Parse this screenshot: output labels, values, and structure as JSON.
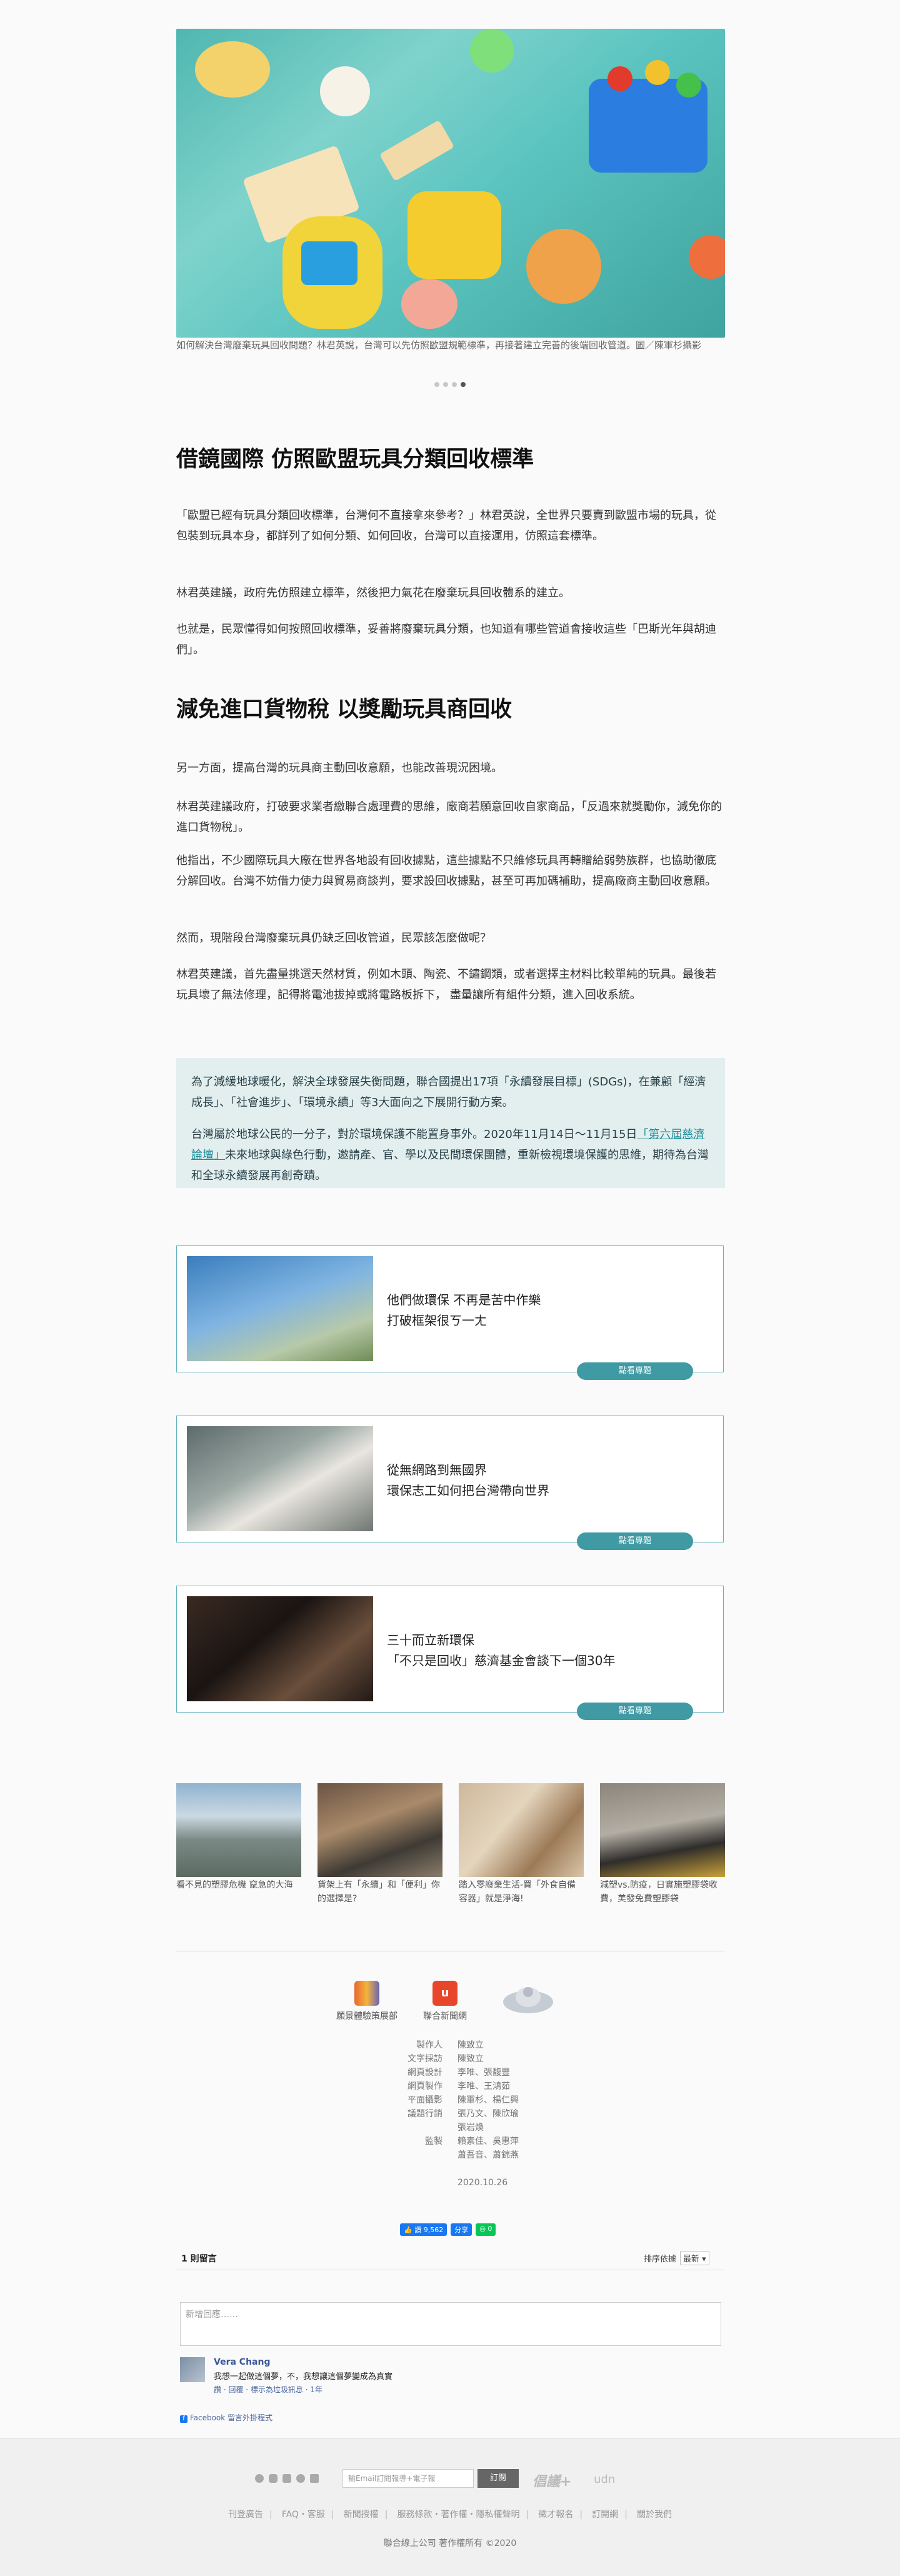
{
  "hero": {
    "caption": "如何解決台灣廢棄玩具回收問題？林君英說，台灣可以先仿照歐盟規範標準，再接著建立完善的後端回收管道。圖／陳軍杉攝影"
  },
  "section1": {
    "heading": "借鏡國際 仿照歐盟玩具分類回收標準",
    "paragraphs": [
      "「歐盟已經有玩具分類回收標準，台灣何不直接拿來參考？」林君英說，全世界只要賣到歐盟市場的玩具，從包裝到玩具本身，都詳列了如何分類、如何回收，台灣可以直接運用，仿照這套標準。",
      "林君英建議，政府先仿照建立標準，然後把力氣花在廢棄玩具回收體系的建立。",
      "也就是，民眾懂得如何按照回收標準，妥善將廢棄玩具分類，也知道有哪些管道會接收這些「巴斯光年與胡迪們」。"
    ]
  },
  "section2": {
    "heading": "減免進口貨物稅 以獎勵玩具商回收",
    "paragraphs": [
      "另一方面，提高台灣的玩具商主動回收意願，也能改善現況困境。",
      "林君英建議政府，打破要求業者繳聯合處理費的思維，廠商若願意回收自家商品，「反過來就獎勵你，減免你的進口貨物稅」。",
      "他指出，不少國際玩具大廠在世界各地設有回收據點，這些據點不只維修玩具再轉贈給弱勢族群，也協助徹底分解回收。台灣不妨借力使力與貿易商談判，要求設回收據點，甚至可再加碼補助，提高廠商主動回收意願。",
      "然而，現階段台灣廢棄玩具仍缺乏回收管道，民眾該怎麼做呢？",
      "林君英建議，首先盡量挑選天然材質，例如木頭、陶瓷、不鏽鋼類，或者選擇主材料比較單純的玩具。最後若玩具壞了無法修理，記得將電池拔掉或將電路板拆下， 盡量讓所有組件分類，進入回收系統。"
    ]
  },
  "quote": {
    "p1": "為了減緩地球暖化，解決全球發展失衡問題，聯合國提出17項「永續發展目標」(SDGs)，在兼顧「經濟成長」、「社會進步」、「環境永續」等3大面向之下展開行動方案。",
    "p2_before": "台灣屬於地球公民的一分子，對於環境保護不能置身事外。2020年11月14日～11月15日",
    "p2_link": "「第六屆慈濟論壇」",
    "p2_after": "未來地球與綠色行動，邀請產、官、學以及民間環保團體，重新檢視環境保護的思維，期待為台灣和全球永續發展再創奇蹟。"
  },
  "cards": [
    {
      "line1": "他們做環保 不再是苦中作樂",
      "line2": "打破框架很ㄎ一ㄤ",
      "button": "點看專題"
    },
    {
      "line1": "從無網路到無國界",
      "line2": "環保志工如何把台灣帶向世界",
      "button": "點看專題"
    },
    {
      "line1": "三十而立新環保",
      "line2": "「不只是回收」慈濟基金會談下一個30年",
      "button": "點看專題"
    }
  ],
  "related": [
    {
      "title": "看不見的塑膠危機 竄急的大海"
    },
    {
      "title": "貨架上有「永續」和「便利」你的選擇是?"
    },
    {
      "title": "踏入零廢棄生活-買「外食自備容器」就是淨海!"
    },
    {
      "title": "減塑vs.防疫，日實施塑膠袋收費，美發免費塑膠袋"
    }
  ],
  "logos": {
    "visual": "願景體驗策展部",
    "udn": "聯合新聞網"
  },
  "credits": [
    {
      "role": "製作人",
      "names": [
        "陳致立"
      ]
    },
    {
      "role": "文字採訪",
      "names": [
        "陳致立"
      ]
    },
    {
      "role": "網頁設計",
      "names": [
        "李唯、張馥豐"
      ]
    },
    {
      "role": "網頁製作",
      "names": [
        "李唯、王鴻茹"
      ]
    },
    {
      "role": "平面攝影",
      "names": [
        "陳軍杉、楊仁興"
      ]
    },
    {
      "role": "議題行銷",
      "names": [
        "張乃文、陳欣瑜",
        "張岩煥"
      ]
    },
    {
      "role": "監製",
      "names": [
        "賴素佳、吳惠萍",
        "蕭吾音、蕭錦燕"
      ]
    }
  ],
  "date": "2020.10.26",
  "social": {
    "like": "讚 9,562",
    "share": "分享",
    "badge": "0"
  },
  "comments": {
    "count": "1 則留言",
    "sort_label": "排序依據",
    "sort_value": "最新",
    "input_placeholder": "新增回應……",
    "author": "Vera Chang",
    "text": "我想一起做這個夢，不，我想讓這個夢變成為真實",
    "actions": "讚 · 回覆 · 標示為垃圾訊息 · 1年",
    "plugin": "Facebook 留言外掛程式"
  },
  "footer": {
    "subscribe_placeholder": "輸Email訂閱報導+電子報",
    "subscribe_button": "訂閱",
    "brand1": "倡議+",
    "brand2": "udn",
    "links": [
      "刊登廣告",
      "FAQ・客服",
      "新聞授權",
      "服務條款・著作權・隱私權聲明",
      "徵才報名",
      "訂閱網",
      "關於我們"
    ],
    "copyright": "聯合線上公司 著作權所有 ©2020"
  }
}
